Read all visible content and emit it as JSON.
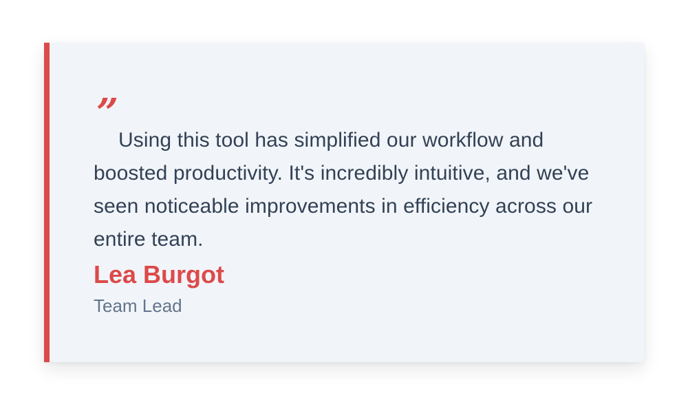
{
  "testimonial": {
    "quote_mark": "”",
    "quote": "Using this tool has simplified our workflow and boosted productivity. It's incredibly intuitive, and we've seen noticeable improvements in efficiency across our entire team.",
    "author": "Lea Burgot",
    "role": "Team Lead"
  },
  "colors": {
    "accent": "#dc4a4a",
    "card_background": "#f1f5f9",
    "body_text": "#334155",
    "muted_text": "#64748b"
  }
}
